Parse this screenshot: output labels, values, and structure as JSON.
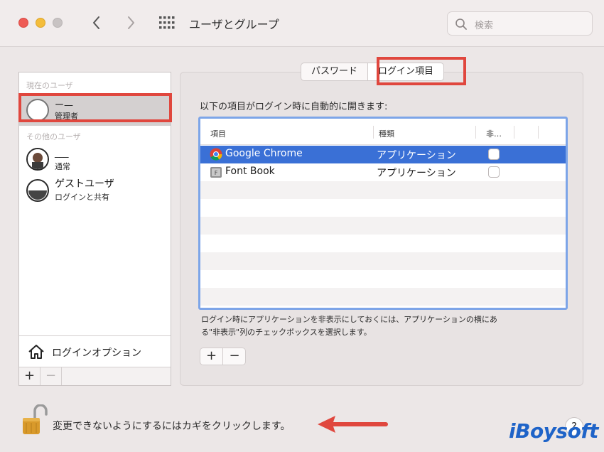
{
  "window": {
    "title": "ユーザとグループ",
    "search_placeholder": "検索"
  },
  "sidebar": {
    "current_section": "現在のユーザ",
    "other_section": "その他のユーザ",
    "users": [
      {
        "name": "ー—",
        "role": "管理者",
        "selected": true
      },
      {
        "name": "___",
        "role": "通常",
        "selected": false
      },
      {
        "name": "ゲストユーザ",
        "role": "ログインと共有",
        "selected": false
      }
    ],
    "login_options": "ログインオプション",
    "add": "+",
    "remove": "−"
  },
  "tabs": [
    {
      "label": "パスワード",
      "active": false
    },
    {
      "label": "ログイン項目",
      "active": true
    }
  ],
  "main": {
    "description": "以下の項目がログイン時に自動的に開きます:",
    "columns": [
      "項目",
      "種類",
      "非…"
    ],
    "rows": [
      {
        "item": "Google Chrome",
        "kind": "アプリケーション",
        "hide": false,
        "selected": true
      },
      {
        "item": "Font Book",
        "kind": "アプリケーション",
        "hide": false,
        "selected": false
      }
    ],
    "note_line1": "ログイン時にアプリケーションを非表示にしておくには、アプリケーションの横にあ",
    "note_line2": "る\"非表示\"列のチェックボックスを選択します。",
    "add": "+",
    "remove": "−"
  },
  "footer": {
    "lock_text": "変更できないようにするにはカギをクリックします。",
    "help": "?",
    "watermark": "iBoysoft"
  },
  "colors": {
    "highlight": "#e0473e",
    "selection": "#3a70d6",
    "table_focus": "#7da5e8"
  }
}
